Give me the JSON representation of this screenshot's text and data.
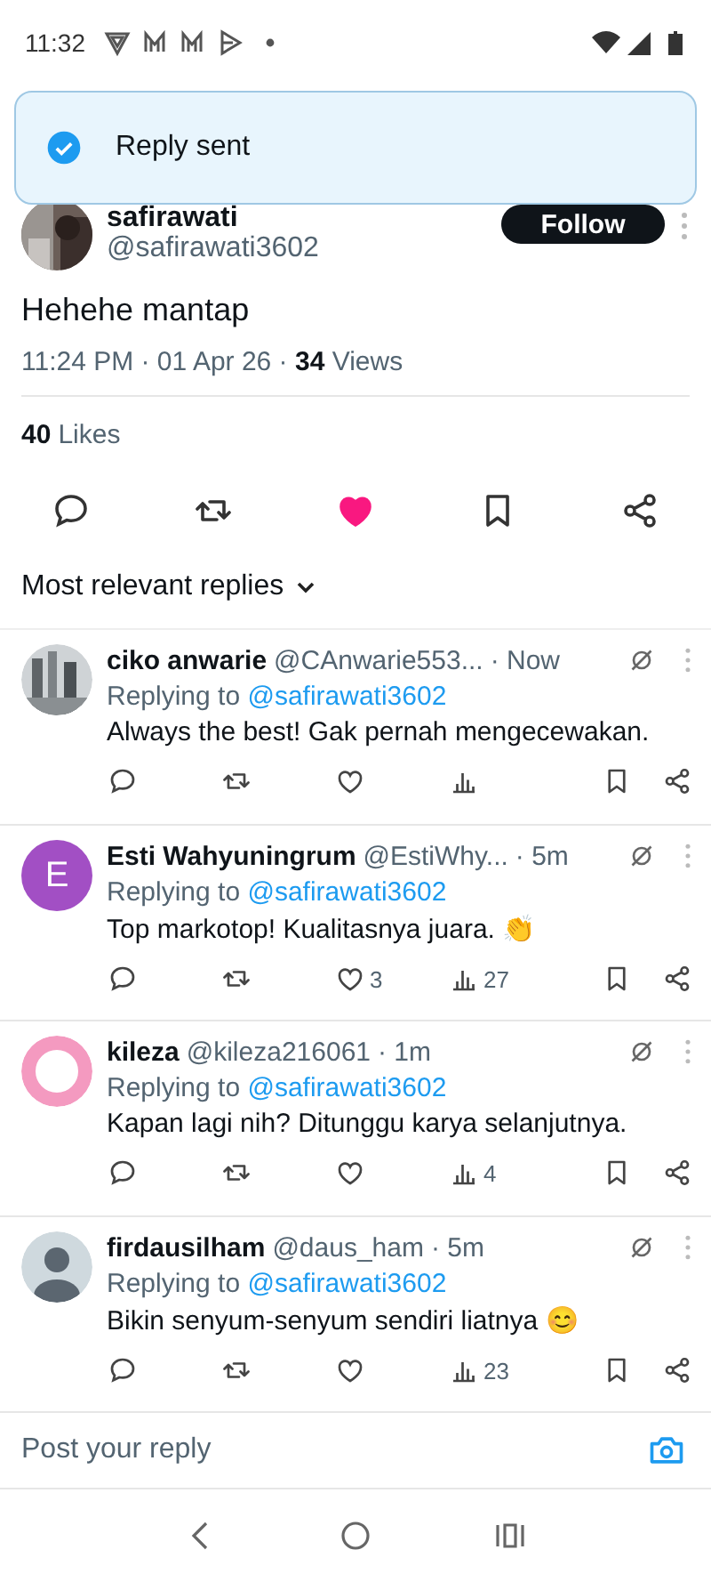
{
  "status_bar": {
    "time": "11:32"
  },
  "toast": {
    "text": "Reply sent"
  },
  "post": {
    "author_name": "safirawati",
    "author_handle": "@safirawati3602",
    "follow_label": "Follow",
    "text": "Hehehe mantap",
    "meta": "11:24 PM · 01 Apr 26 · **34** Views",
    "likes_count": "40",
    "likes_label": "Likes",
    "liked": true,
    "bookmarked": false
  },
  "replies_filter": {
    "label": "Most relevant replies"
  },
  "replies": [
    {
      "name": "ciko anwarie",
      "handle": "@CAnwarie553...",
      "time": "· Now",
      "replying_label": "Replying to",
      "replying_to": "@safirawati3602",
      "text": "Always the best! Gak pernah mengecewakan.",
      "liked": false
    },
    {
      "avatar": {
        "kind": "letter",
        "letter": "E",
        "color": "#a24fc4"
      },
      "name": "Esti Wahyuningrum",
      "handle": "@EstiWhy...",
      "time": "· 5m",
      "replying_label": "Replying to",
      "replying_to": "@safirawati3602",
      "text": "Top markotop! Kualitasnya juara. 👏",
      "liked": false,
      "like_count": "3",
      "view_count": "27"
    },
    {
      "avatar": {
        "kind": "ring",
        "color": "#f49ac0"
      },
      "name": "kileza",
      "handle": "@kileza216061",
      "time": "· 1m",
      "replying_label": "Replying to",
      "replying_to": "@safirawati3602",
      "text": "Kapan lagi nih? Ditunggu karya selanjutnya.",
      "liked": false,
      "view_count": "4"
    },
    {
      "avatar": {
        "kind": "default"
      },
      "name": "firdausilham",
      "handle": "@daus_ham",
      "time": "· 5m",
      "replying_label": "Replying to",
      "replying_to": "@safirawati3602",
      "text": "Bikin senyum-senyum sendiri liatnya 😊",
      "liked": false,
      "view_count": "23"
    }
  ],
  "reply_bar": {
    "placeholder": "Post your reply"
  }
}
